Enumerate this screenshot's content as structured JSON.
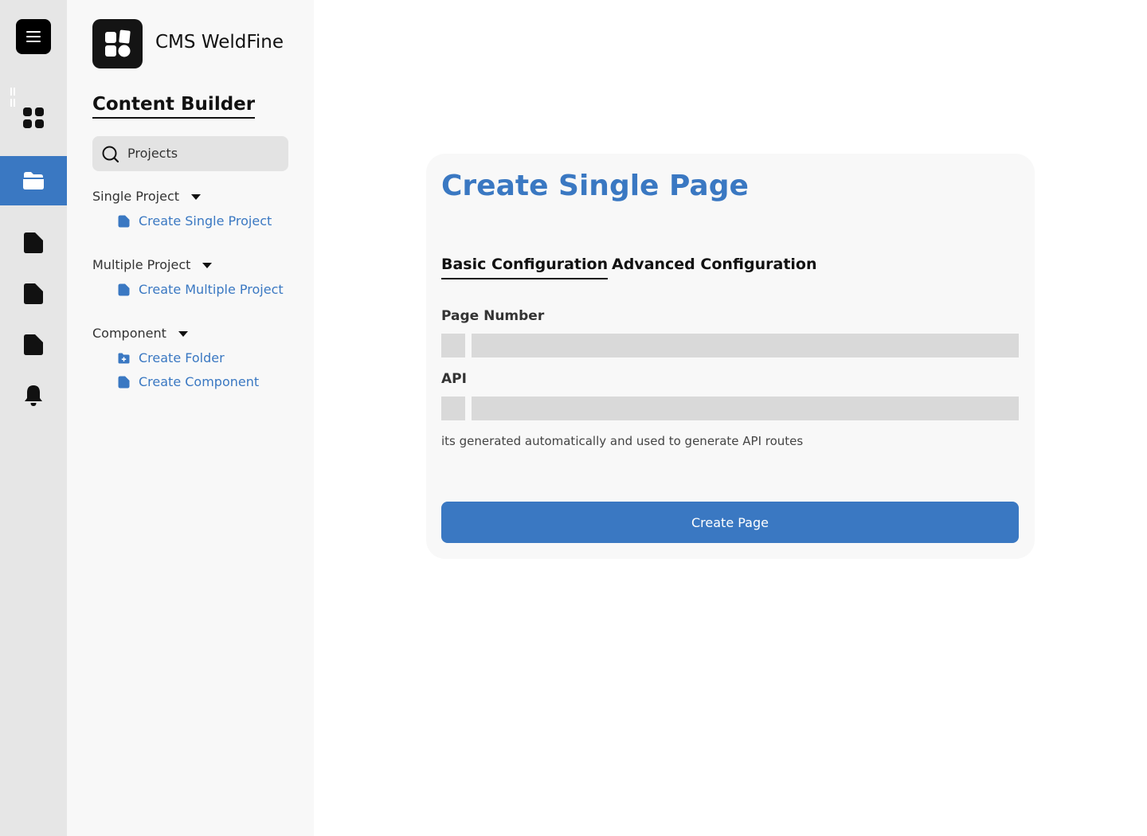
{
  "brand": {
    "name": "CMS WeldFine"
  },
  "sidebar": {
    "title": "Content Builder",
    "search": {
      "placeholder": "Projects"
    },
    "groups": [
      {
        "label": "Single Project",
        "items": [
          {
            "label": "Create Single Project",
            "icon": "file-icon"
          }
        ]
      },
      {
        "label": "Multiple Project",
        "items": [
          {
            "label": "Create Multiple Project",
            "icon": "file-icon"
          }
        ]
      },
      {
        "label": "Component",
        "items": [
          {
            "label": "Create Folder",
            "icon": "folder-plus-icon"
          },
          {
            "label": "Create Component",
            "icon": "file-icon"
          }
        ]
      }
    ]
  },
  "rail": {
    "items": [
      {
        "icon": "dashboard-icon",
        "active": false
      },
      {
        "icon": "folder-open-icon",
        "active": true
      },
      {
        "icon": "file-icon",
        "active": false
      },
      {
        "icon": "file-icon",
        "active": false
      },
      {
        "icon": "file-icon",
        "active": false
      },
      {
        "icon": "bell-icon",
        "active": false
      }
    ]
  },
  "main": {
    "title": "Create Single Page",
    "tabs": [
      {
        "label": "Basic Configuration",
        "active": true
      },
      {
        "label": "Advanced Configuration",
        "active": false
      }
    ],
    "fields": {
      "page_number": {
        "label": "Page Number",
        "value": ""
      },
      "api": {
        "label": "API",
        "value": ""
      }
    },
    "hint": "its generated automatically and used to generate API routes",
    "submit_label": "Create Page"
  },
  "colors": {
    "accent": "#3a78c2",
    "rail_bg": "#e6e6e6",
    "sidebar_bg": "#f8f8f8",
    "input_bg": "#d9d9d9"
  }
}
